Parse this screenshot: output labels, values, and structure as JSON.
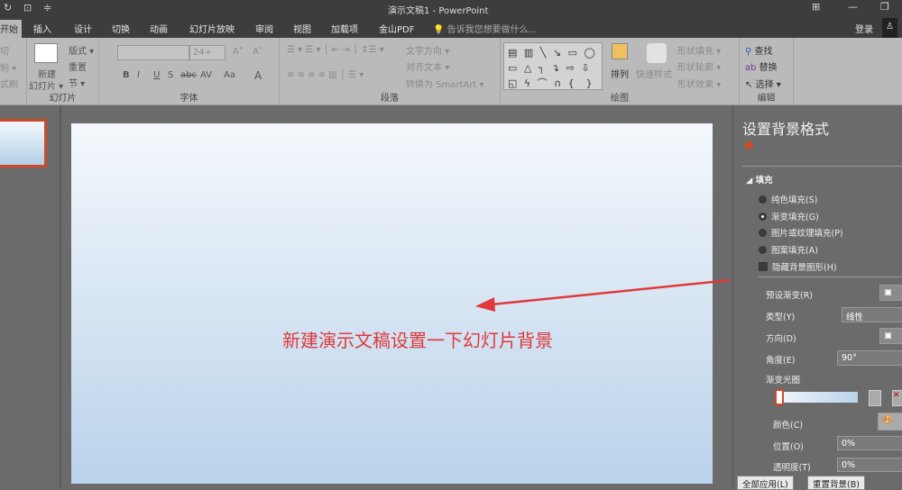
{
  "window": {
    "title": "演示文稿1 - PowerPoint",
    "login": "登录"
  },
  "tabs": [
    "开始",
    "插入",
    "设计",
    "切换",
    "动画",
    "幻灯片放映",
    "审阅",
    "视图",
    "加载项",
    "金山PDF"
  ],
  "tell_me": "告诉我您想要做什么...",
  "ribbon": {
    "clipboard": {
      "cut": "切",
      "copy": "制 ▾",
      "painter": "式刷"
    },
    "slides": {
      "new_slide_1": "新建",
      "new_slide_2": "幻灯片 ▾",
      "layout": "版式 ▾",
      "reset": "重置",
      "section": "节 ▾",
      "label": "幻灯片"
    },
    "font": {
      "size": "24+",
      "bold": "B",
      "italic": "I",
      "underline": "U",
      "shadow": "S",
      "strike": "abc",
      "spacing": "AV",
      "case": "Aa",
      "color": "A",
      "label": "字体"
    },
    "paragraph": {
      "text_dir": "文字方向 ▾",
      "align_text": "对齐文本 ▾",
      "smartart": "转换为 SmartArt ▾",
      "label": "段落"
    },
    "drawing": {
      "arrange": "排列",
      "quick_styles": "快速样式",
      "fill": "形状填充 ▾",
      "outline": "形状轮廓 ▾",
      "effects": "形状效果 ▾",
      "label": "绘图"
    },
    "editing": {
      "find": "查找",
      "replace": "替换",
      "select": "选择 ▾",
      "label": "编辑"
    }
  },
  "annotation": "新建演示文稿设置一下幻灯片背景",
  "format_pane": {
    "title": "设置背景格式",
    "section": "填充",
    "options": [
      "纯色填充(S)",
      "渐变填充(G)",
      "图片或纹理填充(P)",
      "图案填充(A)"
    ],
    "selected_option": 1,
    "hide_bg": "隐藏背景图形(H)",
    "preset": "预设渐变(R)",
    "type_label": "类型(Y)",
    "type_value": "线性",
    "direction": "方向(D)",
    "angle_label": "角度(E)",
    "angle_value": "90°",
    "stops_label": "渐变光圈",
    "color_label": "颜色(C)",
    "position_label": "位置(O)",
    "position_value": "0%",
    "transparency_label": "透明度(T)",
    "transparency_value": "0%",
    "apply_all": "全部应用(L)",
    "reset_bg": "重置背景(B)"
  },
  "colors": {
    "accent": "#d04a2a",
    "annotation": "#e0393a"
  }
}
